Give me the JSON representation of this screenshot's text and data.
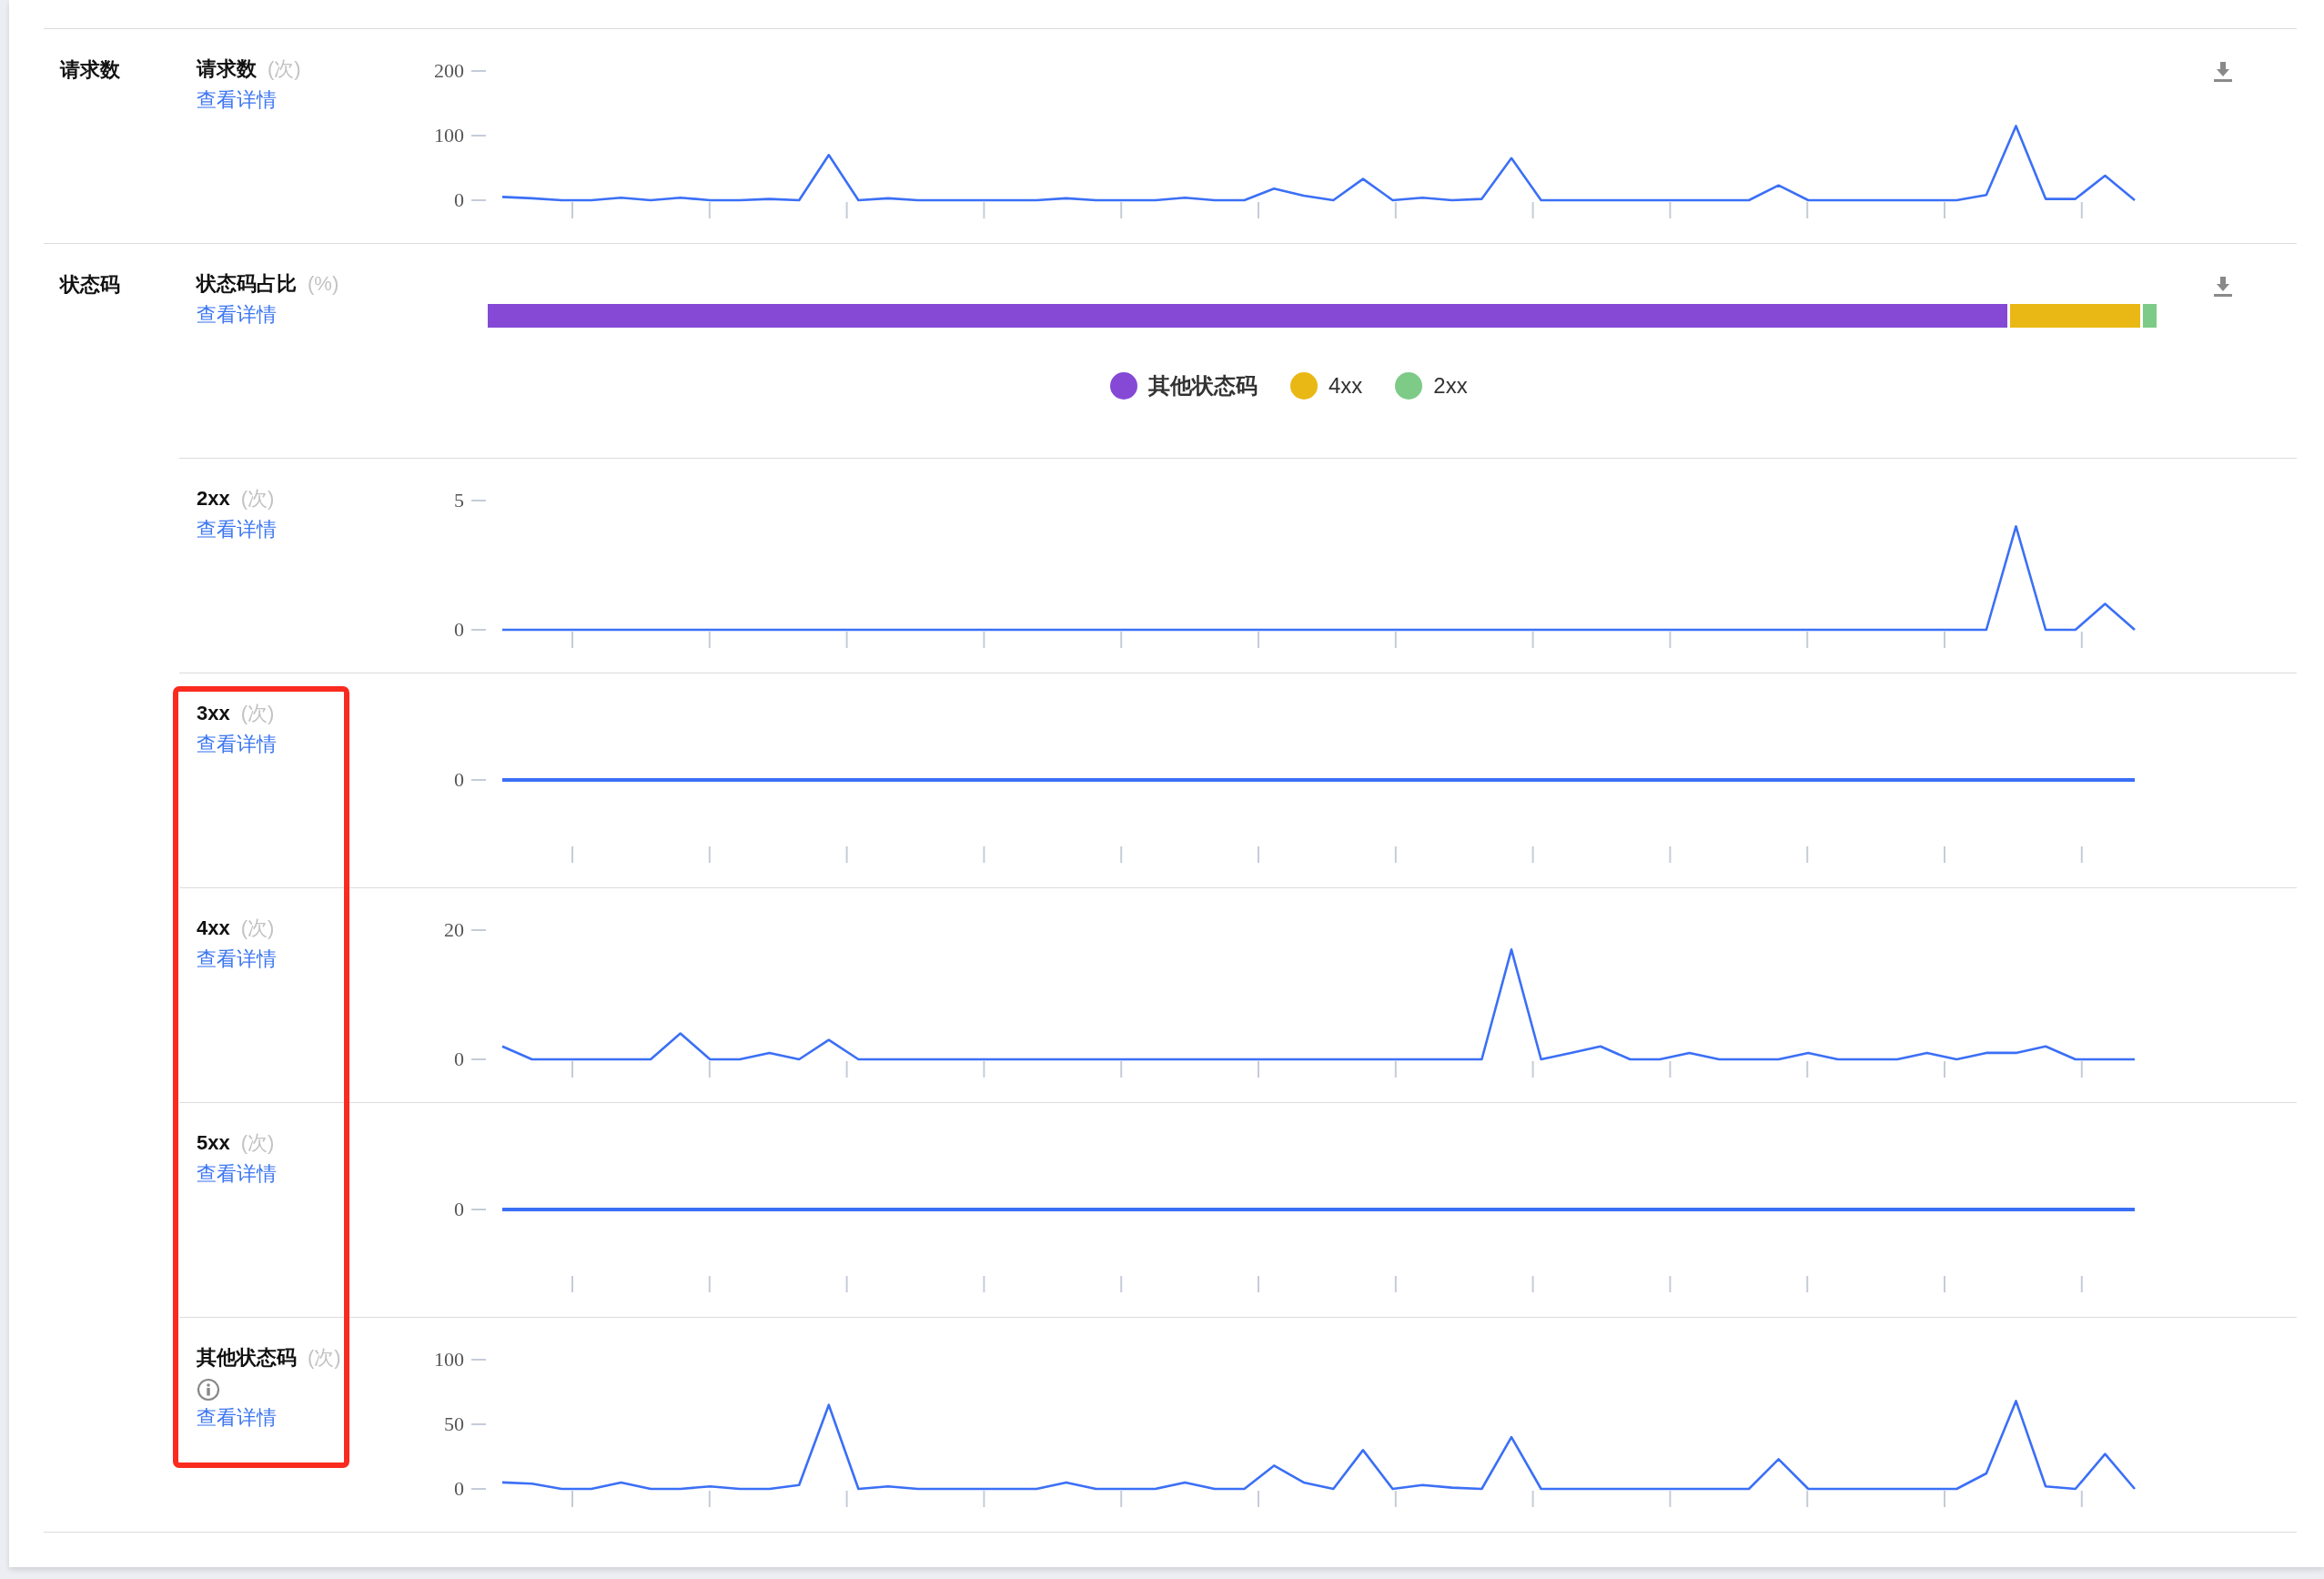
{
  "sections": [
    {
      "title": "请求数",
      "rows": [
        {
          "kind": "chart",
          "title": "请求数",
          "unit": "(次)",
          "link": "查看详情",
          "download": true,
          "chart_data": {
            "type": "line",
            "yticks": [
              0,
              100,
              200
            ],
            "ylim": [
              0,
              200
            ],
            "series": [
              {
                "color": "#3b6ff6",
                "values": [
                  5,
                  3,
                  0,
                  0,
                  4,
                  0,
                  4,
                  0,
                  0,
                  2,
                  0,
                  70,
                  0,
                  3,
                  0,
                  0,
                  0,
                  0,
                  0,
                  3,
                  0,
                  0,
                  0,
                  4,
                  0,
                  0,
                  18,
                  7,
                  0,
                  33,
                  0,
                  4,
                  0,
                  2,
                  65,
                  0,
                  0,
                  0,
                  0,
                  0,
                  0,
                  0,
                  0,
                  23,
                  0,
                  0,
                  0,
                  0,
                  0,
                  0,
                  8,
                  115,
                  2,
                  2,
                  38,
                  0
                ]
              }
            ]
          }
        }
      ]
    },
    {
      "title": "状态码",
      "rows": [
        {
          "kind": "share",
          "title": "状态码占比",
          "unit": "(%)",
          "link": "查看详情",
          "download": true,
          "segments": [
            {
              "label": "其他状态码",
              "color": "#8549d6"
            },
            {
              "label": "4xx",
              "color": "#e9b815"
            },
            {
              "label": "2xx",
              "color": "#7dcb86"
            }
          ]
        },
        {
          "kind": "chart",
          "title": "2xx",
          "unit": "(次)",
          "link": "查看详情",
          "chart_data": {
            "type": "line",
            "yticks": [
              0,
              5
            ],
            "ylim": [
              0,
              5
            ],
            "series": [
              {
                "color": "#3b6ff6",
                "values": [
                  0,
                  0,
                  0,
                  0,
                  0,
                  0,
                  0,
                  0,
                  0,
                  0,
                  0,
                  0,
                  0,
                  0,
                  0,
                  0,
                  0,
                  0,
                  0,
                  0,
                  0,
                  0,
                  0,
                  0,
                  0,
                  0,
                  0,
                  0,
                  0,
                  0,
                  0,
                  0,
                  0,
                  0,
                  0,
                  0,
                  0,
                  0,
                  0,
                  0,
                  0,
                  0,
                  0,
                  0,
                  0,
                  0,
                  0,
                  0,
                  0,
                  0,
                  0,
                  4,
                  0,
                  0,
                  1,
                  0
                ]
              }
            ]
          }
        },
        {
          "kind": "flat",
          "title": "3xx",
          "unit": "(次)",
          "link": "查看详情",
          "axis_label": "0"
        },
        {
          "kind": "chart",
          "title": "4xx",
          "unit": "(次)",
          "link": "查看详情",
          "chart_data": {
            "type": "line",
            "yticks": [
              0,
              20
            ],
            "ylim": [
              0,
              20
            ],
            "series": [
              {
                "color": "#3b6ff6",
                "values": [
                  2,
                  0,
                  0,
                  0,
                  0,
                  0,
                  4,
                  0,
                  0,
                  1,
                  0,
                  3,
                  0,
                  0,
                  0,
                  0,
                  0,
                  0,
                  0,
                  0,
                  0,
                  0,
                  0,
                  0,
                  0,
                  0,
                  0,
                  0,
                  0,
                  0,
                  0,
                  0,
                  0,
                  0,
                  17,
                  0,
                  1,
                  2,
                  0,
                  0,
                  1,
                  0,
                  0,
                  0,
                  1,
                  0,
                  0,
                  0,
                  1,
                  0,
                  1,
                  1,
                  2,
                  0,
                  0,
                  0
                ]
              }
            ]
          }
        },
        {
          "kind": "flat",
          "title": "5xx",
          "unit": "(次)",
          "link": "查看详情",
          "axis_label": "0"
        },
        {
          "kind": "chart",
          "title": "其他状态码",
          "unit": "(次)",
          "link": "查看详情",
          "info": true,
          "chart_data": {
            "type": "line",
            "yticks": [
              0,
              50,
              100
            ],
            "ylim": [
              0,
              100
            ],
            "series": [
              {
                "color": "#3b6ff6",
                "values": [
                  5,
                  4,
                  0,
                  0,
                  5,
                  0,
                  0,
                  2,
                  0,
                  0,
                  3,
                  65,
                  0,
                  2,
                  0,
                  0,
                  0,
                  0,
                  0,
                  5,
                  0,
                  0,
                  0,
                  5,
                  0,
                  0,
                  18,
                  5,
                  0,
                  30,
                  0,
                  3,
                  1,
                  0,
                  40,
                  0,
                  0,
                  0,
                  0,
                  0,
                  0,
                  0,
                  0,
                  23,
                  0,
                  0,
                  0,
                  0,
                  0,
                  0,
                  12,
                  68,
                  2,
                  0,
                  27,
                  0
                ]
              }
            ]
          }
        }
      ]
    }
  ]
}
